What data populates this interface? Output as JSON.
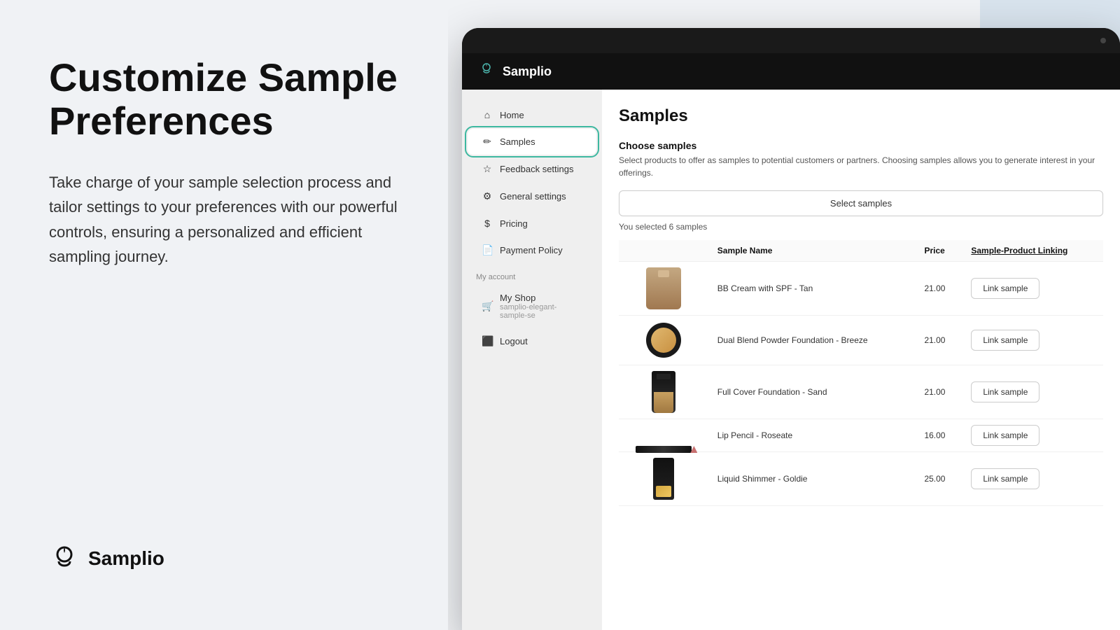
{
  "left": {
    "hero_title": "Customize Sample Preferences",
    "hero_desc": "Take charge of your sample selection process and tailor settings to your preferences with our powerful controls, ensuring a personalized and efficient sampling journey.",
    "logo_text": "Samplio"
  },
  "app": {
    "brand_name": "Samplio",
    "nav": {
      "items": [
        {
          "id": "home",
          "label": "Home",
          "icon": "⌂"
        },
        {
          "id": "samples",
          "label": "Samples",
          "icon": "✏️",
          "active": true,
          "circled": true
        },
        {
          "id": "feedback",
          "label": "Feedback settings",
          "icon": "☆"
        },
        {
          "id": "general",
          "label": "General settings",
          "icon": "⚙"
        },
        {
          "id": "pricing",
          "label": "Pricing",
          "icon": "$"
        },
        {
          "id": "payment",
          "label": "Payment Policy",
          "icon": "📄"
        }
      ],
      "my_account_label": "My account",
      "my_shop_label": "My Shop",
      "my_shop_sub": "samplio-elegant-sample-se",
      "logout_label": "Logout"
    },
    "main": {
      "page_title": "Samples",
      "choose_title": "Choose samples",
      "choose_desc": "Select products to offer as samples to potential customers or partners. Choosing samples allows you to generate interest in your offerings.",
      "select_btn": "Select samples",
      "selected_count": "You selected 6 samples",
      "table": {
        "columns": [
          "",
          "Sample Name",
          "Price",
          "Sample-Product Linking"
        ],
        "rows": [
          {
            "product": "bb_cream",
            "name": "BB Cream with SPF - Tan",
            "price": "21.00",
            "emoji": "🧴"
          },
          {
            "product": "powder",
            "name": "Dual Blend Powder Foundation - Breeze",
            "price": "21.00",
            "emoji": "🪞"
          },
          {
            "product": "foundation",
            "name": "Full Cover Foundation - Sand",
            "price": "21.00",
            "emoji": "🧴"
          },
          {
            "product": "lip_pencil",
            "name": "Lip Pencil - Roseate",
            "price": "16.00",
            "emoji": "✏️"
          },
          {
            "product": "shimmer",
            "name": "Liquid Shimmer - Goldie",
            "price": "25.00",
            "emoji": "✨"
          }
        ],
        "link_btn_label": "Link sample"
      }
    }
  }
}
